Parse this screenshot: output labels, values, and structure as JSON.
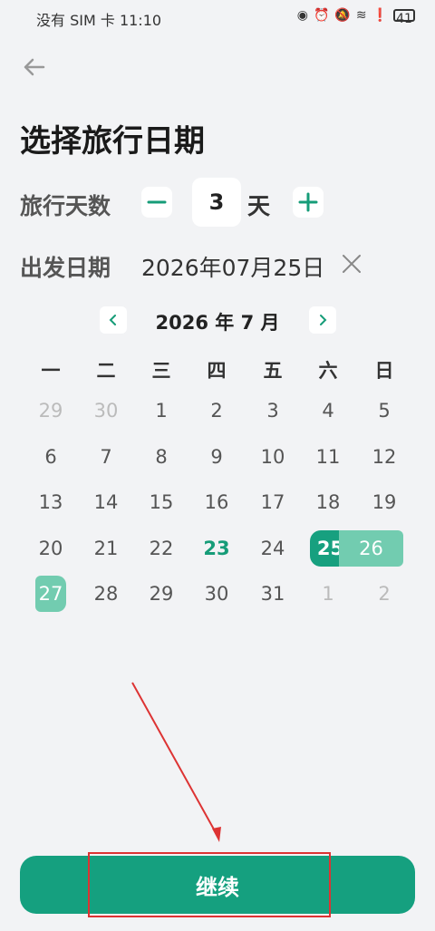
{
  "status_bar": {
    "carrier_time": "没有 SIM 卡 11:10",
    "battery": "41",
    "icons": [
      "eye-icon",
      "alarm-icon",
      "mute-icon",
      "wifi-icon",
      "alert-icon",
      "battery-icon"
    ]
  },
  "header": {
    "title": "选择旅行日期"
  },
  "trip_days": {
    "label": "旅行天数",
    "value": "3",
    "unit": "天",
    "decrement_icon": "minus-icon",
    "increment_icon": "plus-icon"
  },
  "departure": {
    "label": "出发日期",
    "value": "2026年07月25日",
    "clear_icon": "close-icon"
  },
  "calendar": {
    "month_label": "2026 年 7 月",
    "weekdays": [
      "一",
      "二",
      "三",
      "四",
      "五",
      "六",
      "日"
    ],
    "rows": [
      [
        "29",
        "30",
        "1",
        "2",
        "3",
        "4",
        "5"
      ],
      [
        "6",
        "7",
        "8",
        "9",
        "10",
        "11",
        "12"
      ],
      [
        "13",
        "14",
        "15",
        "16",
        "17",
        "18",
        "19"
      ],
      [
        "20",
        "21",
        "22",
        "23",
        "24",
        "25",
        "26"
      ],
      [
        "27",
        "28",
        "29",
        "30",
        "31",
        "1",
        "2"
      ]
    ],
    "today": "23",
    "selected_start": "25",
    "selected_range": [
      "25",
      "26",
      "27"
    ]
  },
  "colors": {
    "accent": "#15a07f",
    "range": "#72ccb0",
    "annotation": "#dd3333"
  },
  "footer": {
    "continue_label": "继续"
  }
}
